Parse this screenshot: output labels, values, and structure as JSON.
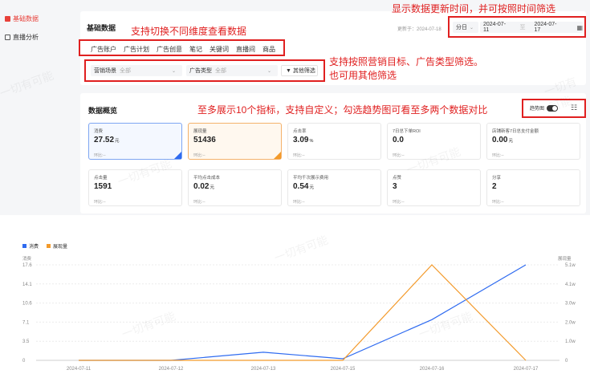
{
  "sidebar": {
    "items": [
      {
        "label": "基础数据",
        "active": true
      },
      {
        "label": "直播分析",
        "active": false
      }
    ]
  },
  "header": {
    "title": "基础数据",
    "update_label": "更新于：2024-07-18",
    "granularity": "分日",
    "date_start": "2024-07-11",
    "date_sep": "至",
    "date_end": "2024-07-17"
  },
  "tabs": [
    "广告账户",
    "广告计划",
    "广告创意",
    "笔记",
    "关键词",
    "直播间",
    "商品"
  ],
  "filters": {
    "scene_label": "营销场景",
    "scene_value": "全部",
    "type_label": "广告类型",
    "type_value": "全部",
    "other_label": "其他筛选"
  },
  "overview": {
    "title": "数据概览",
    "trend_label": "趋势图",
    "cards": [
      {
        "label": "消费",
        "value": "27.52",
        "unit": "元",
        "compare": "环比:--"
      },
      {
        "label": "展现量",
        "value": "51436",
        "unit": "",
        "compare": "环比:--"
      },
      {
        "label": "点击率",
        "value": "3.09",
        "unit": "%",
        "compare": "环比:--"
      },
      {
        "label": "7日总下单ROI",
        "value": "0.0",
        "unit": "",
        "compare": "环比:--"
      },
      {
        "label": "店铺新客7日总支付金额",
        "value": "0.00",
        "unit": "元",
        "compare": "环比:--"
      },
      {
        "label": "点击量",
        "value": "1591",
        "unit": "",
        "compare": "环比:--"
      },
      {
        "label": "平均点击成本",
        "value": "0.02",
        "unit": "元",
        "compare": "环比:--"
      },
      {
        "label": "平均千次展示费用",
        "value": "0.54",
        "unit": "元",
        "compare": "环比:--"
      },
      {
        "label": "点赞",
        "value": "3",
        "unit": "",
        "compare": "环比:--"
      },
      {
        "label": "分享",
        "value": "2",
        "unit": "",
        "compare": "环比:--"
      }
    ]
  },
  "annotations": {
    "top_right": "显示数据更新时间，并可按照时间筛选",
    "dimension": "支持切换不同维度查看数据",
    "filter_line1": "支持按照营销目标、广告类型筛选。",
    "filter_line2": "也可用其他筛选",
    "metrics": "至多展示10个指标，支持自定义；勾选趋势图可看至多两个数据对比"
  },
  "watermark": "一切有可能",
  "colors": {
    "accent": "#2f6bf0",
    "orange": "#f39a2b",
    "annotation": "#e02020",
    "sidebar_active": "#e8413a"
  },
  "chart_data": {
    "type": "line",
    "x": [
      "2024-07-11",
      "2024-07-12",
      "2024-07-13",
      "2024-07-15",
      "2024-07-16",
      "2024-07-17"
    ],
    "series": [
      {
        "name": "消费",
        "axis": "left",
        "color": "#2f6bf0",
        "values": [
          0,
          0,
          1.5,
          0.3,
          7.5,
          17.6
        ]
      },
      {
        "name": "展现量",
        "axis": "right",
        "color": "#f39a2b",
        "values": [
          0,
          0,
          0,
          0,
          51436,
          0
        ]
      }
    ],
    "ylabel_left": "消费",
    "ylabel_right": "展现量",
    "yticks_left": [
      "17.6",
      "14.1",
      "10.6",
      "7.1",
      "3.5",
      "0"
    ],
    "yticks_right": [
      "5.1w",
      "4.1w",
      "3.0w",
      "2.0w",
      "1.0w",
      "0"
    ],
    "ylim_left": [
      0,
      17.6
    ],
    "ylim_right": [
      0,
      51436
    ],
    "legend": "top-left",
    "grid": true
  }
}
